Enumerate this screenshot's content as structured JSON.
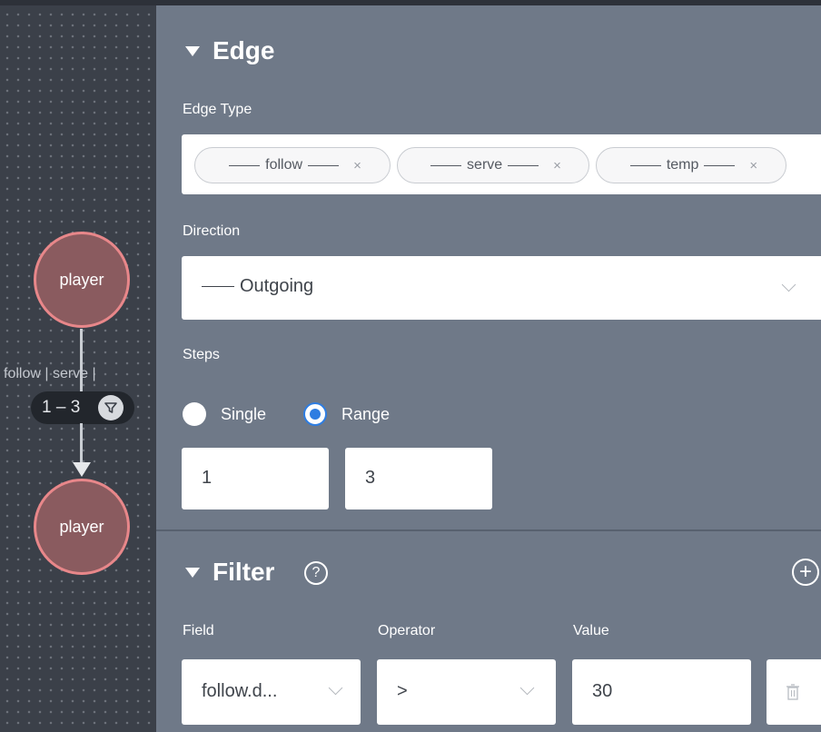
{
  "canvas": {
    "nodes": [
      {
        "label": "player"
      },
      {
        "label": "player"
      }
    ],
    "edge_label": "follow | serve |",
    "step_range": "1 – 3"
  },
  "edge_section": {
    "title": "Edge",
    "edge_type_label": "Edge Type",
    "edge_types": [
      "follow",
      "serve",
      "temp"
    ],
    "remove_symbol": "×",
    "direction_label": "Direction",
    "direction_value": "Outgoing",
    "steps_label": "Steps",
    "step_modes": [
      {
        "label": "Single",
        "selected": false
      },
      {
        "label": "Range",
        "selected": true
      }
    ],
    "step_min": "1",
    "step_max": "3"
  },
  "filter_section": {
    "title": "Filter",
    "help_symbol": "?",
    "add_symbol": "+",
    "field_label": "Field",
    "operator_label": "Operator",
    "value_label": "Value",
    "field_value": "follow.d...",
    "operator_value": ">",
    "value_value": "30"
  },
  "colors": {
    "canvas_bg": "#3b4049",
    "panel_bg": "#6f7988",
    "node_fill": "#8a5b5f",
    "node_border": "#e8878a",
    "radio_selected": "#2e7de1"
  },
  "icons": {
    "filter": "filter-funnel-icon",
    "help": "help-circle-icon",
    "add": "plus-circle-icon",
    "delete": "trash-icon",
    "dropdown": "chevron-down-icon"
  }
}
